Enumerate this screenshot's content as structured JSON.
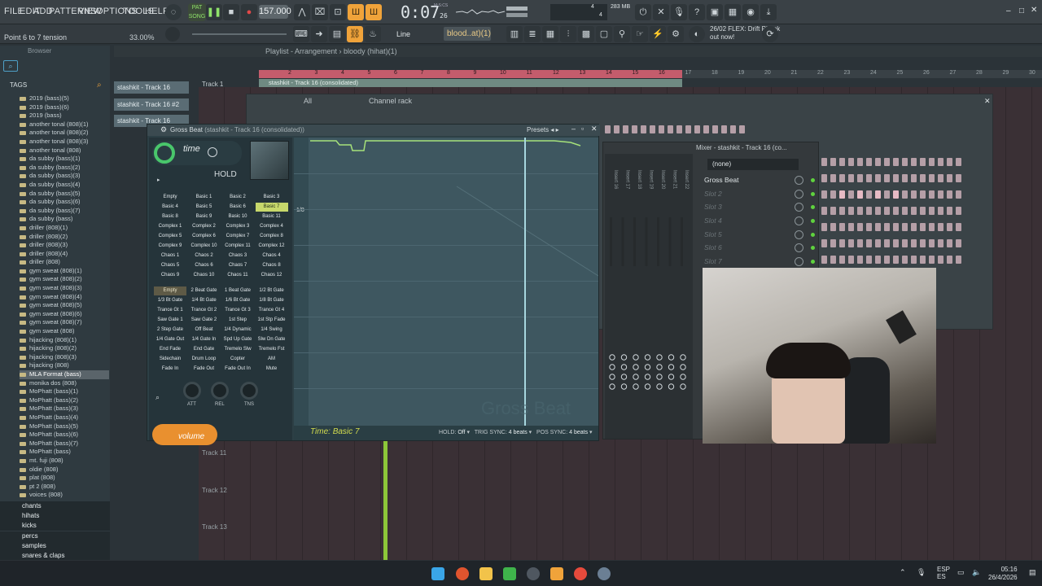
{
  "menu": [
    "FILE",
    "EDIT",
    "ADD",
    "PATTERNS",
    "VIEW",
    "OPTIONS",
    "TOOLS",
    "HELP"
  ],
  "transport": {
    "song_label": "SONG",
    "pat_label": "PAT",
    "tempo": "157.000",
    "time": "0:07",
    "time_sub": "26",
    "time_unit": "M:S:CS",
    "cpu_mem": "283 MB",
    "cpu_num": "4",
    "cpu_num2": "4"
  },
  "toolbar2": {
    "hint": "Point 6 to 7 tension",
    "zoom": "33.00%",
    "snap": "Line",
    "pattern": "blood..at)(1)",
    "news_date": "26/02",
    "news_line1": "FLEX: Drift Phonk",
    "news_line2": "out now!"
  },
  "browser": {
    "title": "Browser",
    "tags_label": "TAGS",
    "items": [
      "2019 (bass)(5)",
      "2019 (bass)(6)",
      "2019 (bass)",
      "another tonal (808)(1)",
      "another tonal (808)(2)",
      "another tonal (808)(3)",
      "another tonal (808)",
      "da subby (bass)(1)",
      "da subby (bass)(2)",
      "da subby (bass)(3)",
      "da subby (bass)(4)",
      "da subby (bass)(5)",
      "da subby (bass)(6)",
      "da subby (bass)(7)",
      "da subby (bass)",
      "driller (808)(1)",
      "driller (808)(2)",
      "driller (808)(3)",
      "driller (808)(4)",
      "driller (808)",
      "gym sweat (808)(1)",
      "gym sweat (808)(2)",
      "gym sweat (808)(3)",
      "gym sweat (808)(4)",
      "gym sweat (808)(5)",
      "gym sweat (808)(6)",
      "gym sweat (808)(7)",
      "gym sweat (808)",
      "hijacking (808)(1)",
      "hijacking (808)(2)",
      "hijacking (808)(3)",
      "hijacking (808)",
      "MLA Format (bass)",
      "monika dos (808)",
      "MoPhatt (bass)(1)",
      "MoPhatt (bass)(2)",
      "MoPhatt (bass)(3)",
      "MoPhatt (bass)(4)",
      "MoPhatt (bass)(5)",
      "MoPhatt (bass)(6)",
      "MoPhatt (bass)(7)",
      "MoPhatt (bass)",
      "mt. fuji (808)",
      "oldie (808)",
      "plat (808)",
      "pt 2 (808)",
      "voices (808)"
    ],
    "selected_index": 32,
    "categories": [
      "chants",
      "hihats",
      "kicks",
      "percs",
      "samples",
      "snares & claps"
    ]
  },
  "playlist": {
    "title": "Playlist - Arrangement",
    "pattern": "bloody (hihat)(1)",
    "track1": "Track 1",
    "track_buttons": [
      "stashkit - Track 16",
      "stashkit - Track 16 #2",
      "stashkit - Track 16"
    ],
    "clip_label": "stashkit - Track 16 (consolidated)",
    "ruler_numbers": [
      "2",
      "3",
      "4",
      "5",
      "6",
      "7",
      "8",
      "9",
      "10",
      "11",
      "12",
      "13",
      "14",
      "15",
      "16",
      "17",
      "18",
      "19",
      "20",
      "21",
      "22",
      "23",
      "24",
      "25",
      "26",
      "27",
      "28",
      "29",
      "30"
    ],
    "lower_tracks": [
      "Track 11",
      "Track 12",
      "Track 13"
    ]
  },
  "channel_rack": {
    "title": "Channel rack",
    "filter": "All"
  },
  "gross_beat": {
    "title": "Gross Beat",
    "subtitle": "(stashkit - Track 16 (consolidated))",
    "presets_label": "Presets",
    "time_label": "time",
    "hold_label": "HOLD",
    "volume_label": "volume",
    "time_presets": [
      "Empty",
      "Basic 1",
      "Basic 2",
      "Basic 3",
      "Basic 4",
      "Basic 5",
      "Basic 6",
      "Basic 7",
      "Basic 8",
      "Basic 9",
      "Basic 10",
      "Basic 11",
      "Complex 1",
      "Complex 2",
      "Complex 3",
      "Complex 4",
      "Complex 5",
      "Complex 6",
      "Complex 7",
      "Complex 8",
      "Complex 9",
      "Complex 10",
      "Complex 11",
      "Complex 12",
      "Chaos 1",
      "Chaos 2",
      "Chaos 3",
      "Chaos 4",
      "Chaos 5",
      "Chaos 6",
      "Chaos 7",
      "Chaos 8",
      "Chaos 9",
      "Chaos 10",
      "Chaos 11",
      "Chaos 12"
    ],
    "time_selected": 7,
    "vol_presets": [
      "Empty",
      "2 Beat Gate",
      "1 Beat Gate",
      "1/2 Bt Gate",
      "1/3 Bt Gate",
      "1/4 Bt Gate",
      "1/6 Bt Gate",
      "1/8 Bt Gate",
      "Trance Gt 1",
      "Trance Gt 2",
      "Trance Gt 3",
      "Trance Gt 4",
      "Saw Gate 1",
      "Saw Gate 2",
      "1st Step",
      "1st Stp Fade",
      "2 Step Gate",
      "Off Beat",
      "1/4 Dynamic",
      "1/4 Swing",
      "1/4 Gate Out",
      "1/4 Gate In",
      "Spd Up Gate",
      "Slw Dn Gate",
      "End Fade",
      "End Gate",
      "Tremelo Slw",
      "Tremelo Fst",
      "Sidechain",
      "Drum Loop",
      "Copter",
      "AM",
      "Fade In",
      "Fade Out",
      "Fade Out In",
      "Mute"
    ],
    "vol_selected": 0,
    "knobs": [
      "ATT",
      "REL",
      "TNS"
    ],
    "status_time": "Time: Basic 7",
    "hold_status": "HOLD:",
    "hold_value": "Off",
    "trig_sync": "TRIG SYNC:",
    "trig_value": "4 beats",
    "pos_sync": "POS SYNC:",
    "pos_value": "4 beats",
    "grid_label": "1/8",
    "watermark": "Gross Beat"
  },
  "mixer": {
    "title": "Mixer - stashkit - Track 16 (co...",
    "slot_select": "(none)",
    "slots": [
      "Gross Beat",
      "Slot 2",
      "Slot 3",
      "Slot 4",
      "Slot 5",
      "Slot 6",
      "Slot 7"
    ],
    "inserts": [
      "Insert 16",
      "Insert 17",
      "Insert 18",
      "Insert 19",
      "Insert 20",
      "Insert 21",
      "Insert 22"
    ]
  },
  "taskbar": {
    "lang1": "ESP",
    "lang2": "ES",
    "time": "05:16",
    "date": "26/4/2026"
  },
  "colors": {
    "accent_green": "#49c66b",
    "accent_orange": "#f0a33a",
    "ruler_red": "#c45c6c",
    "playhead": "#9be23a"
  }
}
